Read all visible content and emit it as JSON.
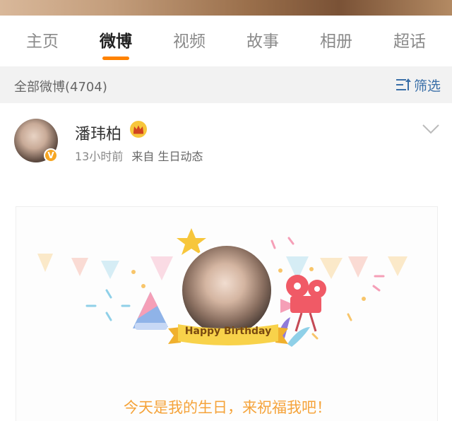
{
  "tabs": [
    {
      "label": "主页"
    },
    {
      "label": "微博"
    },
    {
      "label": "视频"
    },
    {
      "label": "故事"
    },
    {
      "label": "相册"
    },
    {
      "label": "超话"
    }
  ],
  "active_tab": "微博",
  "filter": {
    "count_label": "全部微博(4704)",
    "button_label": "筛选"
  },
  "post": {
    "username": "潘玮柏",
    "time": "13小时前",
    "source": "来自 生日动态",
    "badge": "V",
    "card": {
      "banner_text": "Happy Birthday",
      "message": "今天是我的生日，来祝福我吧！"
    }
  },
  "colors": {
    "accent": "#ff8200",
    "link": "#3a6fa8",
    "message": "#f5a33a"
  }
}
